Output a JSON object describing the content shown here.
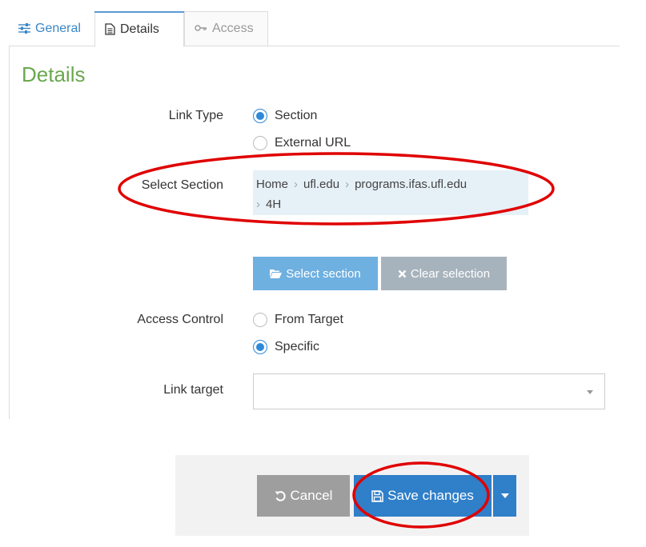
{
  "tabs": [
    {
      "label": "General",
      "icon": "sliders-icon"
    },
    {
      "label": "Details",
      "icon": "document-icon"
    },
    {
      "label": "Access",
      "icon": "key-icon"
    }
  ],
  "section": {
    "title": "Details"
  },
  "link_type": {
    "label": "Link Type",
    "options": [
      "Section",
      "External URL"
    ],
    "selected": "Section"
  },
  "select_section": {
    "label": "Select Section",
    "breadcrumb": [
      "Home",
      "ufl.edu",
      "programs.ifas.ufl.edu",
      "4H"
    ],
    "separator": "›"
  },
  "buttons": {
    "select_section": "Select section",
    "clear_selection": "Clear selection"
  },
  "access_control": {
    "label": "Access Control",
    "options": [
      "From Target",
      "Specific"
    ],
    "selected": "Specific"
  },
  "link_target": {
    "label": "Link target",
    "value": ""
  },
  "footer": {
    "cancel": "Cancel",
    "save": "Save changes"
  },
  "colors": {
    "accent": "#2f7fc9",
    "title_green": "#6aa84f",
    "annotation_red": "#e00000"
  }
}
